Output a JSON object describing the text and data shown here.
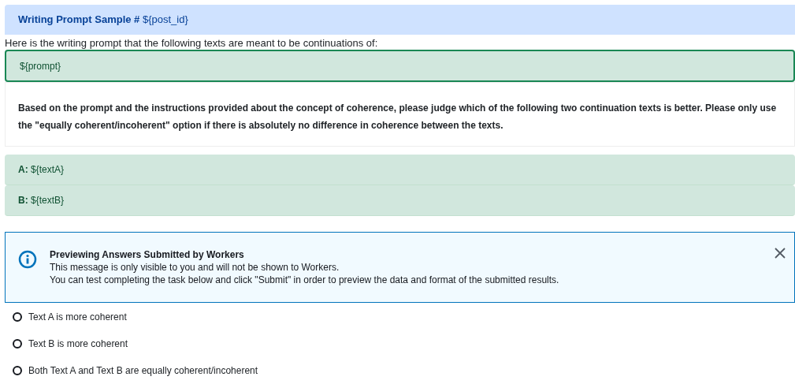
{
  "header": {
    "title": "**Writing Prompt Sample #** ${post_id}"
  },
  "intro": "Here is the writing prompt that the following texts are meant to be continuations of:",
  "prompt": "${prompt}",
  "instructions": "Based on the prompt and the instructions provided about the concept of coherence, please judge which of the following two continuation texts is better. Please only use the \"equally coherent/incoherent\" option if there is absolutely no difference in coherence between the texts.",
  "texts": [
    "**A:** ${textA}",
    "**B:** ${textB}"
  ],
  "alert": {
    "title": "Previewing Answers Submitted by Workers",
    "lines": [
      "This message is only visible to you and will not be shown to Workers.",
      "You can test completing the task below and click \"Submit\" in order to preview the data and format of the submitted results."
    ]
  },
  "options": [
    {
      "label": "Text A is more coherent",
      "selected": false
    },
    {
      "label": "Text B is more coherent",
      "selected": false
    },
    {
      "label": "Both Text A and Text B are equally coherent/incoherent",
      "selected": false
    }
  ]
}
